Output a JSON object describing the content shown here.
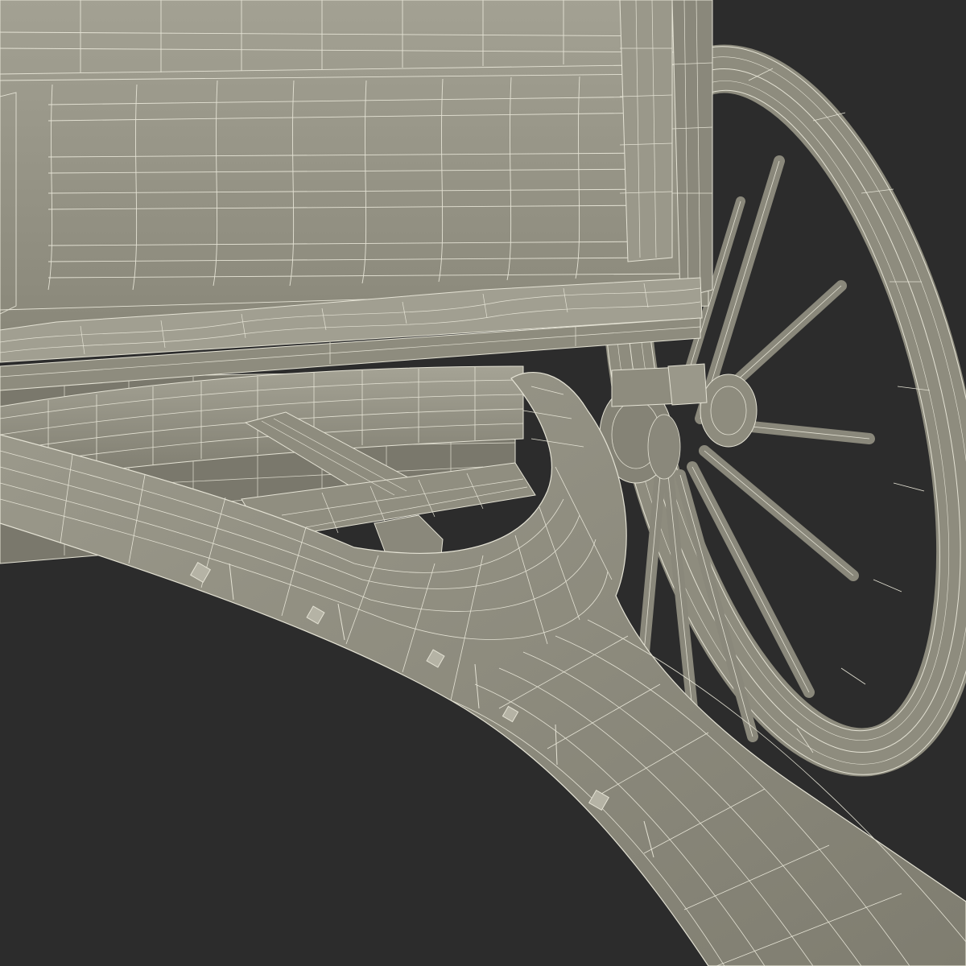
{
  "scene": {
    "subject": "cart-wireframe-render",
    "colors": {
      "background": "#2c2c2c",
      "surface": "#8e8c7e",
      "surface_light": "#a19f91",
      "surface_dark": "#6c6a5f",
      "wire": "#e4e2d4"
    },
    "parts": [
      "wagon-body",
      "floor-planks",
      "wagon-bed",
      "axle-beam",
      "cart-wheel",
      "wheel-hub",
      "curved-tongue",
      "tongue-bolts"
    ]
  }
}
